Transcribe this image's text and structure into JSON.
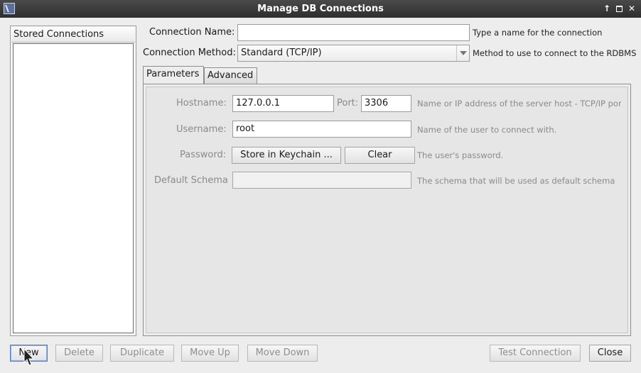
{
  "window": {
    "title": "Manage DB Connections",
    "icons": [
      "app-icon",
      "keep-above-icon",
      "maximize-icon",
      "close-icon"
    ],
    "buttons": {
      "up": "↑",
      "close": "✕"
    }
  },
  "stored": {
    "header": "Stored Connections",
    "items": []
  },
  "form": {
    "connection_name": {
      "label": "Connection Name:",
      "value": "",
      "hint": "Type a name for the connection"
    },
    "connection_method": {
      "label": "Connection Method:",
      "value": "Standard (TCP/IP)",
      "hint": "Method to use to connect to the RDBMS"
    }
  },
  "tabs": [
    {
      "label": "Parameters",
      "active": true
    },
    {
      "label": "Advanced",
      "active": false
    }
  ],
  "params": {
    "hostname": {
      "label": "Hostname:",
      "value": "127.0.0.1"
    },
    "port": {
      "label": "Port:",
      "value": "3306"
    },
    "hostname_hint": "Name or IP address of the server host - TCP/IP por",
    "username": {
      "label": "Username:",
      "value": "root",
      "hint": "Name of the user to connect with."
    },
    "password": {
      "label": "Password:",
      "store_button": "Store in Keychain ...",
      "clear_button": "Clear",
      "hint": "The user's password."
    },
    "schema": {
      "label": "Default Schema",
      "value": "",
      "hint": "The schema that will be used as default schema"
    }
  },
  "bottom": {
    "new": "New",
    "delete": "Delete",
    "duplicate": "Duplicate",
    "move_up": "Move Up",
    "move_down": "Move Down",
    "test_connection": "Test Connection",
    "close": "Close"
  }
}
